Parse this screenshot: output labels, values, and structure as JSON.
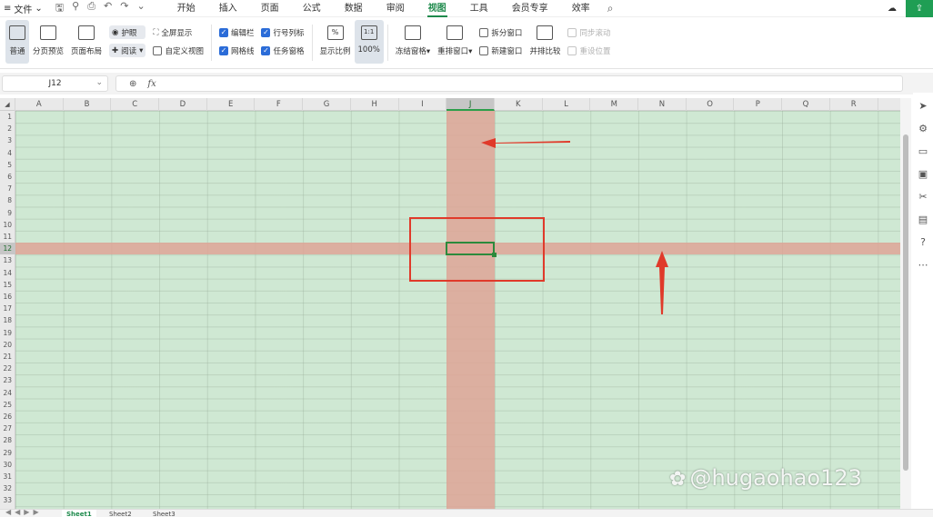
{
  "menu": {
    "file_label": "文件",
    "tabs": [
      "开始",
      "插入",
      "页面",
      "公式",
      "数据",
      "审阅",
      "视图",
      "工具",
      "会员专享",
      "效率"
    ],
    "active_tab": "视图"
  },
  "ribbon": {
    "normal": "普通",
    "page_break_preview": "分页预览",
    "page_layout": "页面布局",
    "eye_protect": "护眼",
    "reading": "阅读",
    "full_screen": "全屏显示",
    "custom_view": "自定义视图",
    "formula_bar": "编辑栏",
    "gridlines": "网格线",
    "row_col_headers": "行号列标",
    "task_pane": "任务窗格",
    "zoom": "显示比例",
    "zoom_100": "100%",
    "zoom_ratio_icon": "1:1",
    "freeze_panes": "冻结窗格",
    "rearrange_windows": "重排窗口",
    "split_window": "拆分窗口",
    "new_window": "新建窗口",
    "side_by_side": "并排比较",
    "sync_scroll": "同步滚动",
    "reset_position": "重设位置"
  },
  "formula_bar": {
    "name_box": "J12",
    "fx": "fx",
    "content": ""
  },
  "grid": {
    "columns": [
      "A",
      "B",
      "C",
      "D",
      "E",
      "F",
      "G",
      "H",
      "I",
      "J",
      "K",
      "L",
      "M",
      "N",
      "O",
      "P",
      "Q",
      "R"
    ],
    "rows": [
      1,
      2,
      3,
      4,
      5,
      6,
      7,
      8,
      9,
      10,
      11,
      12,
      13,
      14,
      15,
      16,
      17,
      18,
      19,
      20,
      21,
      22,
      23,
      24,
      25,
      26,
      27,
      28,
      29,
      30,
      31,
      32,
      33
    ],
    "active_column": "J",
    "active_row": 12,
    "background_color": "#cfe8d3",
    "highlight_color": "#dea596"
  },
  "sheets": [
    "Sheet1",
    "Sheet2",
    "Sheet3"
  ],
  "active_sheet": "Sheet1",
  "watermark": "@hugaohao123"
}
